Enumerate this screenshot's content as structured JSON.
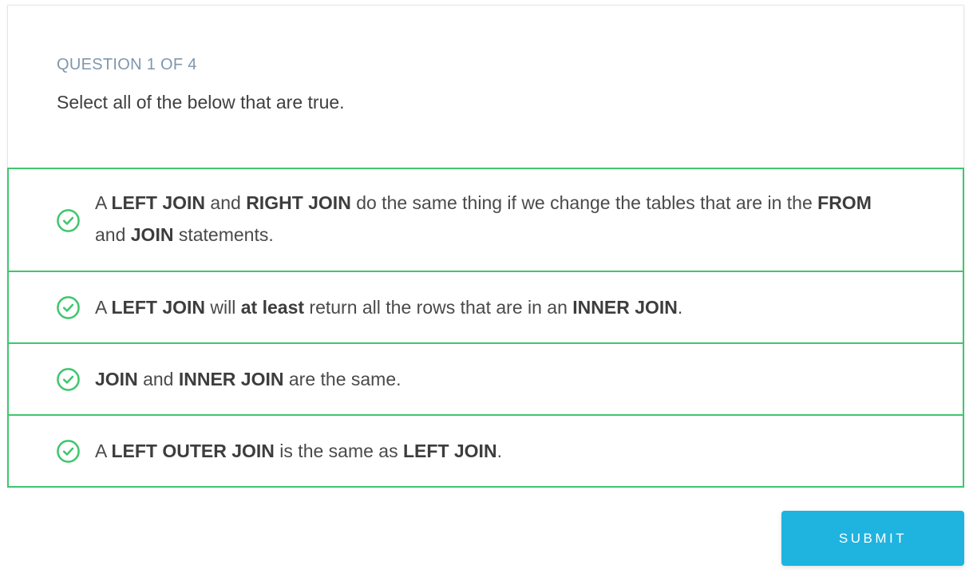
{
  "question": {
    "counter": "QUESTION 1 OF 4",
    "prompt": "Select all of the below that are true."
  },
  "options": [
    {
      "selected": true,
      "icon": "check-circle-icon",
      "segments": [
        {
          "text": "A ",
          "bold": false
        },
        {
          "text": "LEFT JOIN",
          "bold": true
        },
        {
          "text": " and ",
          "bold": false
        },
        {
          "text": "RIGHT JOIN",
          "bold": true
        },
        {
          "text": " do the same thing if we change the tables that are in the ",
          "bold": false
        },
        {
          "text": "FROM",
          "bold": true
        },
        {
          "text": " and ",
          "bold": false
        },
        {
          "text": "JOIN",
          "bold": true
        },
        {
          "text": " statements.",
          "bold": false
        }
      ]
    },
    {
      "selected": true,
      "icon": "check-circle-icon",
      "segments": [
        {
          "text": "A ",
          "bold": false
        },
        {
          "text": "LEFT JOIN",
          "bold": true
        },
        {
          "text": " will ",
          "bold": false
        },
        {
          "text": "at least",
          "bold": true
        },
        {
          "text": " return all the rows that are in an ",
          "bold": false
        },
        {
          "text": "INNER JOIN",
          "bold": true
        },
        {
          "text": ".",
          "bold": false
        }
      ]
    },
    {
      "selected": true,
      "icon": "check-circle-icon",
      "segments": [
        {
          "text": "JOIN",
          "bold": true
        },
        {
          "text": " and ",
          "bold": false
        },
        {
          "text": "INNER JOIN",
          "bold": true
        },
        {
          "text": " are the same.",
          "bold": false
        }
      ]
    },
    {
      "selected": true,
      "icon": "check-circle-icon",
      "segments": [
        {
          "text": "A ",
          "bold": false
        },
        {
          "text": "LEFT OUTER JOIN",
          "bold": true
        },
        {
          "text": " is the same as ",
          "bold": false
        },
        {
          "text": "LEFT JOIN",
          "bold": true
        },
        {
          "text": ".",
          "bold": false
        }
      ]
    }
  ],
  "submit": {
    "label": "SUBMIT"
  },
  "colors": {
    "selected_border": "#3fc66e",
    "accent_button": "#1fb3e0",
    "counter_text": "#7e97ad"
  }
}
